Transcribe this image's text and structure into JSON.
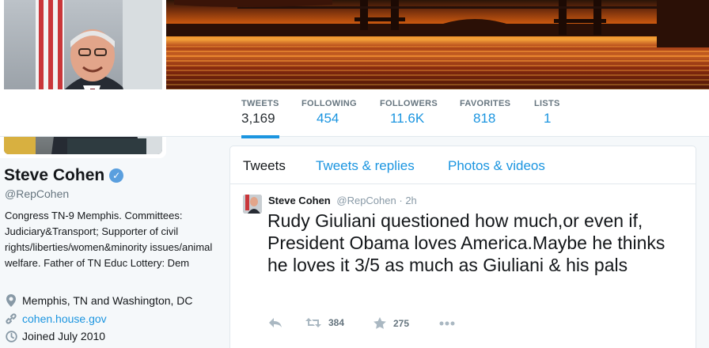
{
  "colors": {
    "link": "#1b95e0",
    "text": "#14171a",
    "muted": "#66757f",
    "background": "#f5f8fa"
  },
  "profile": {
    "name": "Steve Cohen",
    "handle": "@RepCohen",
    "verified_icon": "verified-badge-icon",
    "bio": "Congress TN-9 Memphis. Committees: Judiciary&Transport; Supporter of civil rights/liberties/women&minority issues/animal welfare. Father of TN Educ Lottery: Dem",
    "location": "Memphis, TN and Washington, DC",
    "website": "cohen.house.gov",
    "joined": "Joined July 2010"
  },
  "nav": {
    "stats": [
      {
        "label": "TWEETS",
        "value": "3,169",
        "active": true
      },
      {
        "label": "FOLLOWING",
        "value": "454"
      },
      {
        "label": "FOLLOWERS",
        "value": "11.6K"
      },
      {
        "label": "FAVORITES",
        "value": "818"
      },
      {
        "label": "LISTS",
        "value": "1"
      }
    ]
  },
  "timeline": {
    "tabs": [
      {
        "label": "Tweets",
        "active": true
      },
      {
        "label": "Tweets & replies"
      },
      {
        "label": "Photos & videos"
      }
    ],
    "tweet": {
      "author": "Steve Cohen",
      "handle": "@RepCohen",
      "separator": "·",
      "time": "2h",
      "text": "Rudy Giuliani questioned how much,or even if, President Obama loves America.Maybe he thinks he loves it 3/5 as much as Giuliani & his pals",
      "retweets": "384",
      "favorites": "275"
    }
  }
}
